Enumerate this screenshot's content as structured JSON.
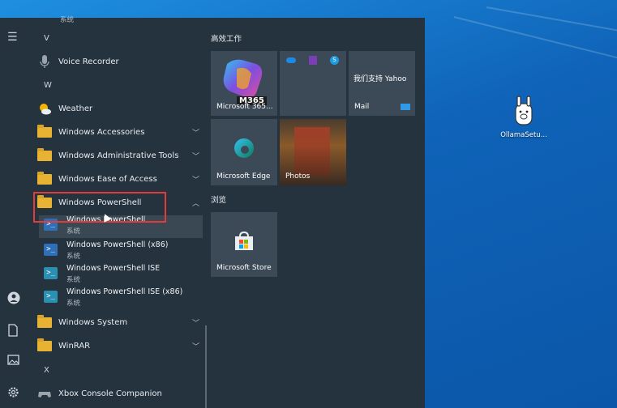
{
  "desktop": {
    "icon_label": "OllamaSetu..."
  },
  "rail": {
    "icons": [
      "hamburger-icon",
      "user-icon",
      "document-icon",
      "pictures-icon",
      "settings-icon"
    ]
  },
  "list": {
    "top_partial": "系统",
    "letter_v": "V",
    "voice_recorder": "Voice Recorder",
    "letter_w": "W",
    "weather": "Weather",
    "win_accessories": "Windows Accessories",
    "win_admin_tools": "Windows Administrative Tools",
    "win_ease": "Windows Ease of Access",
    "win_powershell": "Windows PowerShell",
    "ps1": {
      "title": "Windows PowerShell",
      "sub": "系统"
    },
    "ps2": {
      "title": "Windows PowerShell (x86)",
      "sub": "系统"
    },
    "ps3": {
      "title": "Windows PowerShell ISE",
      "sub": "系统"
    },
    "ps4": {
      "title": "Windows PowerShell ISE (x86)",
      "sub": "系统"
    },
    "win_system": "Windows System",
    "winrar": "WinRAR",
    "letter_x": "X",
    "xbox": "Xbox Console Companion"
  },
  "tiles": {
    "group1": "高效工作",
    "m365": "Microsoft 365...",
    "m365_badge": "M365",
    "yahoo": "我们支持 Yahoo",
    "mail": "Mail",
    "edge": "Microsoft Edge",
    "photos": "Photos",
    "group2": "浏览",
    "store": "Microsoft Store"
  }
}
